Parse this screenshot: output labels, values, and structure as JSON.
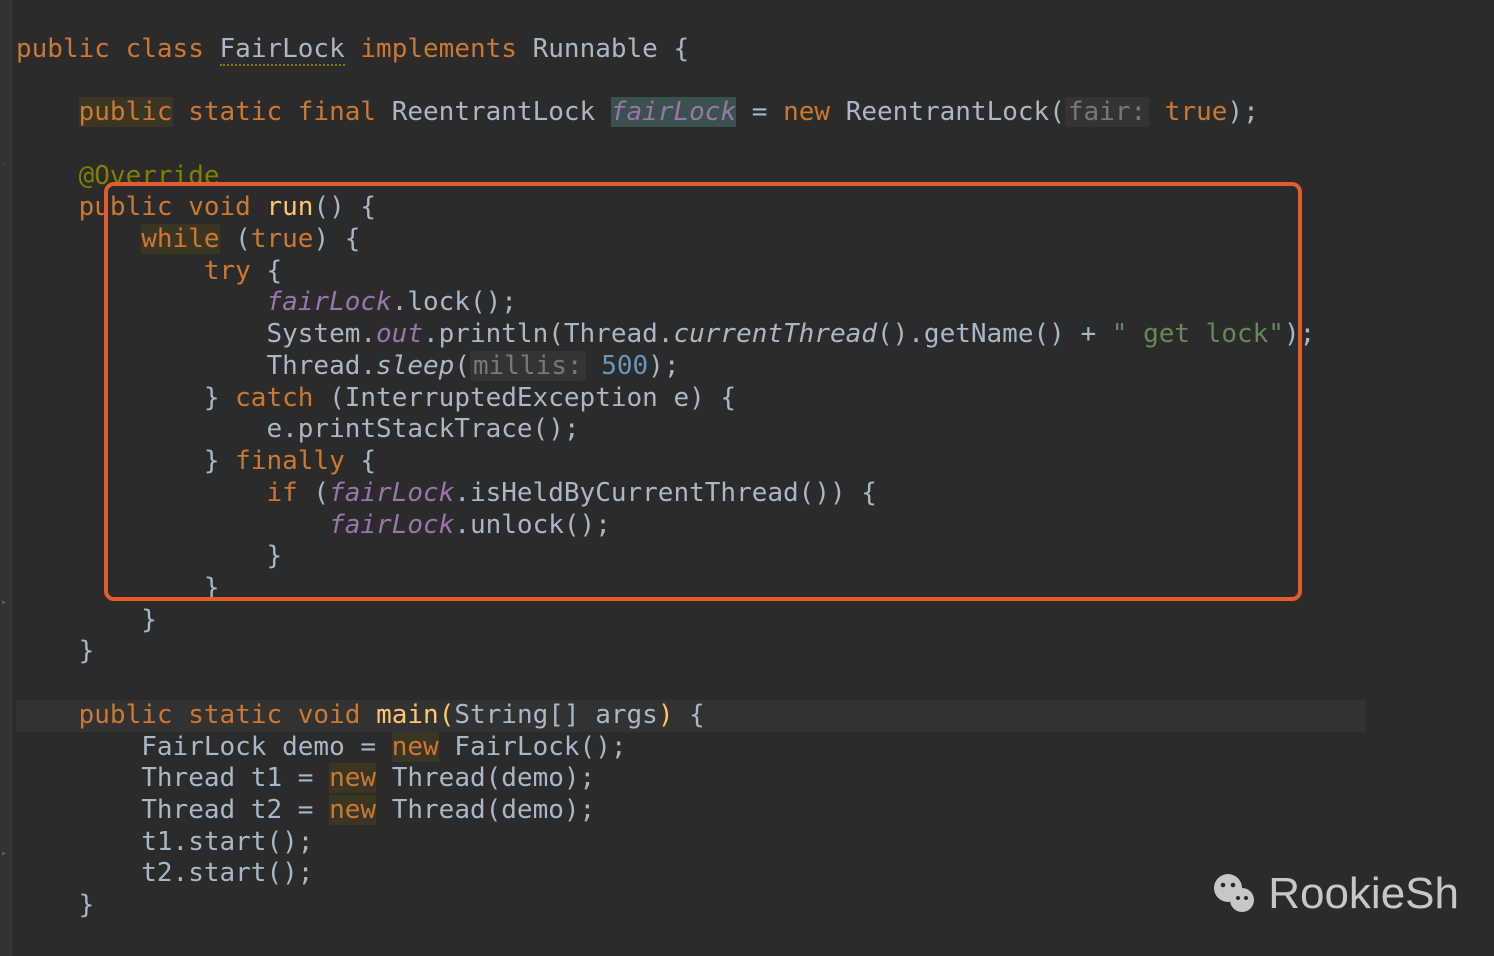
{
  "code": {
    "l1": {
      "kw1": "public",
      "kw2": "class",
      "cls": "FairLock",
      "kw3": "implements",
      "iface": "Runnable",
      "brace": "{"
    },
    "l2": {
      "kw1": "public",
      "kw2": "static",
      "kw3": "final",
      "type": "ReentrantLock",
      "field": "fairLock",
      "eq": "=",
      "kw4": "new",
      "ctor": "ReentrantLock(",
      "hint": "fair:",
      "val": "true",
      "end": ");"
    },
    "l3": {
      "ann": "@Override"
    },
    "l4": {
      "kw1": "public",
      "kw2": "void",
      "mth": "run",
      "rest": "() {"
    },
    "l5": {
      "kw": "while",
      "open": " (",
      "val": "true",
      "rest": ") {"
    },
    "l6": {
      "kw": "try",
      "rest": " {"
    },
    "l7": {
      "field": "fairLock",
      "rest": ".lock();"
    },
    "l8": {
      "a": "System.",
      "out": "out",
      "b": ".println(Thread.",
      "cur": "currentThread",
      "c": "().getName() + ",
      "str": "\" get lock\"",
      "d": ");"
    },
    "l9": {
      "a": "Thread.",
      "sleep": "sleep",
      "b": "(",
      "hint": "millis:",
      "sp": " ",
      "num": "500",
      "c": ");"
    },
    "l10": {
      "a": "} ",
      "kw": "catch",
      "b": " (InterruptedException e) {"
    },
    "l11": {
      "a": "e.printStackTrace();"
    },
    "l12": {
      "a": "} ",
      "kw": "finally",
      "b": " {"
    },
    "l13": {
      "kw": "if",
      "a": " (",
      "field": "fairLock",
      "b": ".isHeldByCurrentThread()) {"
    },
    "l14": {
      "field": "fairLock",
      "a": ".unlock();"
    },
    "l15": {
      "a": "}"
    },
    "l16": {
      "a": "}"
    },
    "l17": {
      "a": "}"
    },
    "l18": {
      "a": "}"
    },
    "l19": {
      "kw1": "public",
      "kw2": "static",
      "kw3": "void",
      "mth": "main",
      "p1": "(",
      "args": "String[] args",
      "p2": ")",
      "rest": " {"
    },
    "l20": {
      "a": "FairLock demo = ",
      "kw": "new",
      "b": " FairLock();"
    },
    "l21": {
      "a": "Thread t1 = ",
      "kw": "new",
      "b": " Thread(demo);"
    },
    "l22": {
      "a": "Thread t2 = ",
      "kw": "new",
      "b": " Thread(demo);"
    },
    "l23": {
      "a": "t1.start();"
    },
    "l24": {
      "a": "t2.start();"
    },
    "l25": {
      "a": "}"
    }
  },
  "watermark": "RookieSh"
}
